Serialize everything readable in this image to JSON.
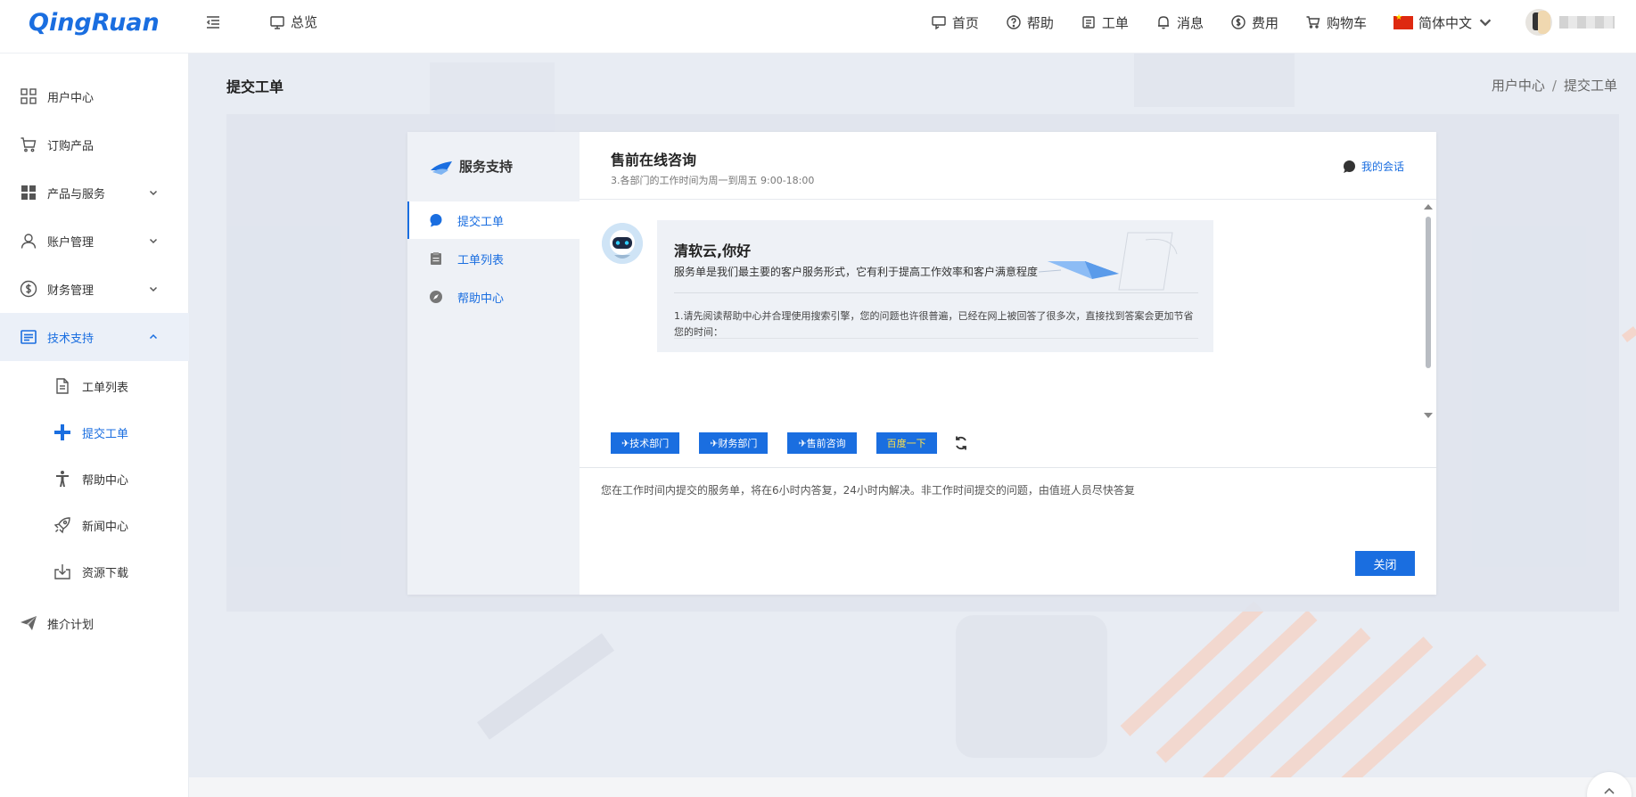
{
  "header": {
    "logo": "QingRuan",
    "overview": "总览",
    "nav": [
      {
        "label": "首页",
        "icon": "home-icon"
      },
      {
        "label": "帮助",
        "icon": "help-icon"
      },
      {
        "label": "工单",
        "icon": "ticket-icon"
      },
      {
        "label": "消息",
        "icon": "bell-icon"
      },
      {
        "label": "费用",
        "icon": "dollar-icon"
      },
      {
        "label": "购物车",
        "icon": "cart-icon"
      }
    ],
    "language": "简体中文"
  },
  "sidebar": {
    "items": [
      {
        "label": "用户中心",
        "icon": "grid-icon"
      },
      {
        "label": "订购产品",
        "icon": "cart-icon"
      },
      {
        "label": "产品与服务",
        "icon": "apps-icon"
      },
      {
        "label": "账户管理",
        "icon": "user-icon"
      },
      {
        "label": "财务管理",
        "icon": "dollar-icon"
      },
      {
        "label": "技术支持",
        "icon": "document-icon"
      }
    ],
    "sub_items": [
      {
        "label": "工单列表",
        "icon": "file-icon"
      },
      {
        "label": "提交工单",
        "icon": "plus-icon"
      },
      {
        "label": "帮助中心",
        "icon": "person-icon"
      },
      {
        "label": "新闻中心",
        "icon": "rocket-icon"
      },
      {
        "label": "资源下载",
        "icon": "download-icon"
      }
    ],
    "last_item": {
      "label": "推介计划",
      "icon": "send-icon"
    }
  },
  "page": {
    "title": "提交工单",
    "breadcrumb": [
      "用户中心",
      "提交工单"
    ],
    "breadcrumb_sep": "/"
  },
  "panel": {
    "left_title": "服务支持",
    "left_items": [
      {
        "label": "提交工单",
        "icon": "chat-icon"
      },
      {
        "label": "工单列表",
        "icon": "clipboard-icon"
      },
      {
        "label": "帮助中心",
        "icon": "compass-icon"
      }
    ],
    "title": "售前在线咨询",
    "subtitle": "3.各部门的工作时间为周一到周五 9:00-18:00",
    "my_chat": "我的会话",
    "greeting": "清软云,你好",
    "greeting_desc": "服务单是我们最主要的客户服务形式，它有利于提高工作效率和客户满意程度",
    "note": "1.请先阅读帮助中心并合理使用搜索引擎，您的问题也许很普遍，已经在网上被回答了很多次，直接找到答案会更加节省您的时间：",
    "quick_buttons": [
      "技术部门",
      "财务部门",
      "售前咨询"
    ],
    "baidu_button": "百度一下",
    "notice": "您在工作时间内提交的服务单，将在6小时内答复，24小时内解决。非工作时间提交的问题，由值班人员尽快答复",
    "close_button": "关闭"
  },
  "colors": {
    "primary": "#1a6ee0",
    "baidu_text": "#ffe14a"
  }
}
